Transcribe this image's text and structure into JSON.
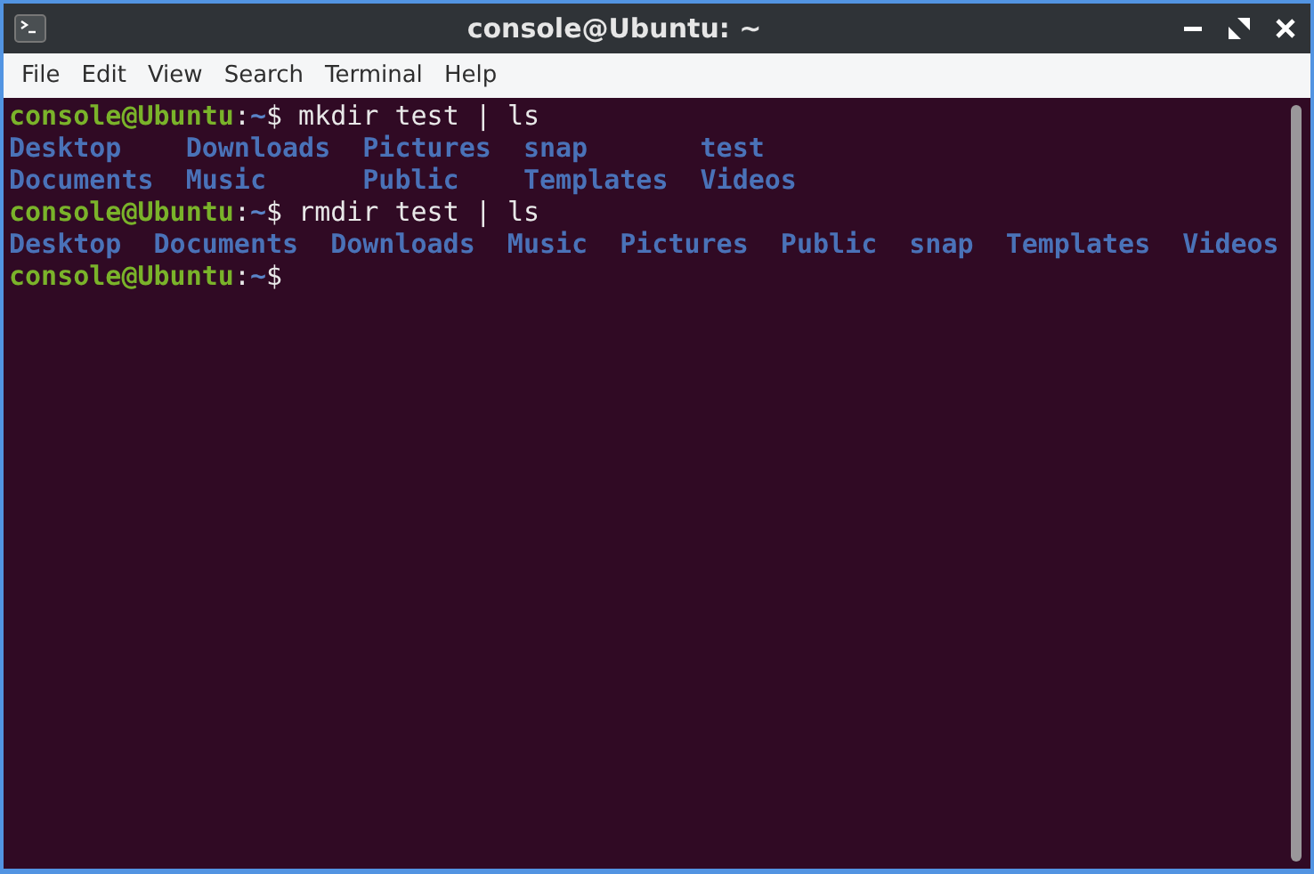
{
  "window": {
    "title": "console@Ubuntu: ~"
  },
  "menu": [
    "File",
    "Edit",
    "View",
    "Search",
    "Terminal",
    "Help"
  ],
  "terminal": {
    "blocks": [
      {
        "kind": "prompt",
        "user": "console@Ubuntu",
        "separator": ":",
        "path": "~",
        "symbol": "$",
        "command": "mkdir test | ls"
      },
      {
        "kind": "listing",
        "rows": [
          [
            "Desktop",
            "Downloads",
            "Pictures",
            "snap",
            "test"
          ],
          [
            "Documents",
            "Music",
            "Public",
            "Templates",
            "Videos"
          ]
        ]
      },
      {
        "kind": "prompt",
        "user": "console@Ubuntu",
        "separator": ":",
        "path": "~",
        "symbol": "$",
        "command": "rmdir test | ls"
      },
      {
        "kind": "listing",
        "rows": [
          [
            "Desktop",
            "Documents",
            "Downloads",
            "Music",
            "Pictures",
            "Public",
            "snap",
            "Templates",
            "Videos"
          ]
        ]
      },
      {
        "kind": "prompt",
        "user": "console@Ubuntu",
        "separator": ":",
        "path": "~",
        "symbol": "$"
      }
    ]
  }
}
